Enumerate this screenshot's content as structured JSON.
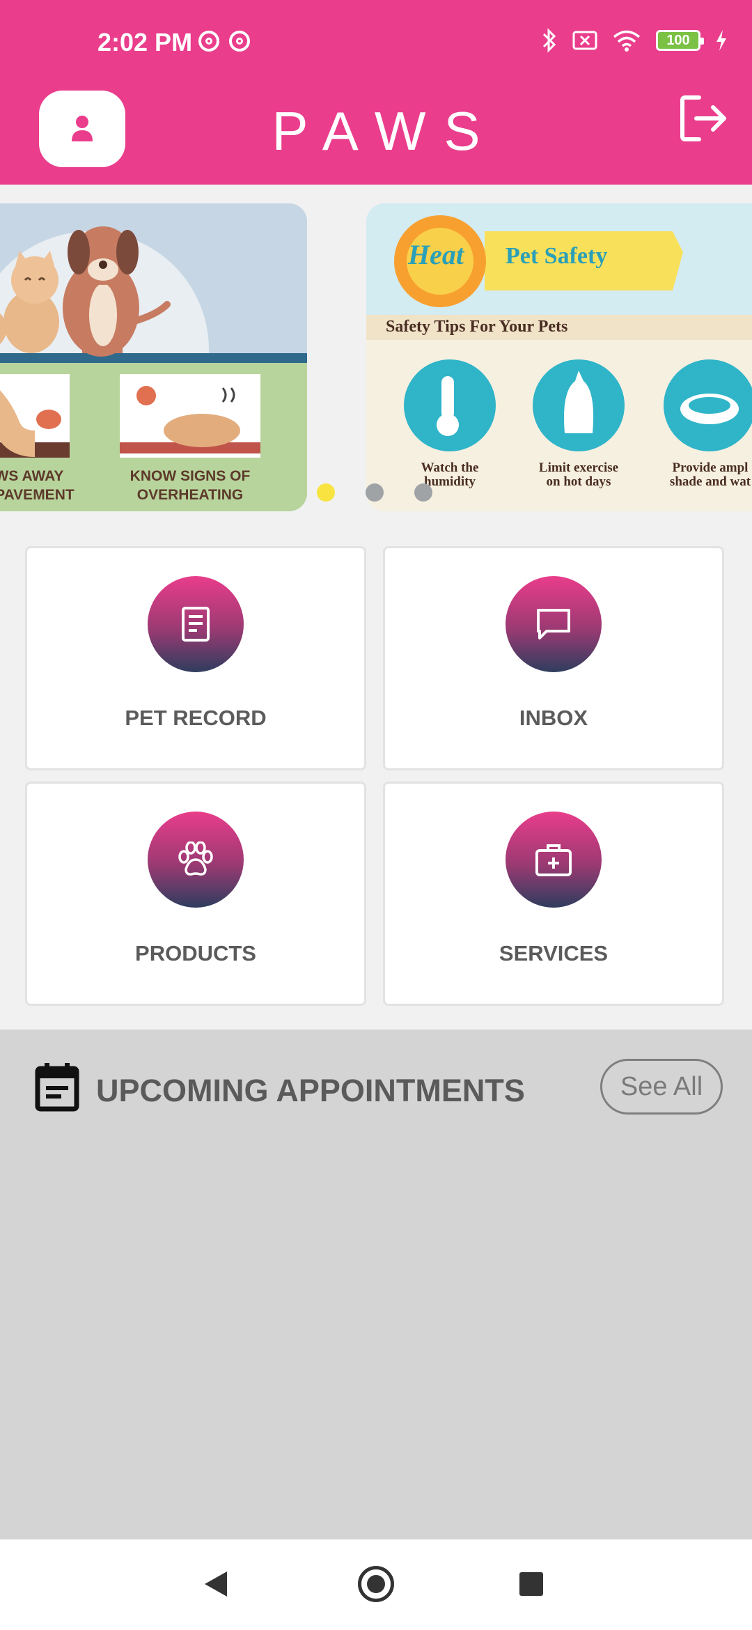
{
  "status_bar": {
    "time": "2:02 PM",
    "battery_level": "100"
  },
  "app": {
    "title": "PAWS"
  },
  "carousel": {
    "slide_left": {
      "captions": [
        "EEP PAWS AWAY\nOM HOT PAVEMENT",
        "KNOW SIGNS OF\nOVERHEATING"
      ]
    },
    "slide_right": {
      "badge": "Heat",
      "banner": "Pet Safety",
      "subtitle": "Safety Tips For Your Pets",
      "tips": [
        "Watch the\nhumidity",
        "Limit exercise\non hot days",
        "Provide ampl\nshade and wat"
      ]
    },
    "active_index": 0,
    "dot_count": 3
  },
  "menu": {
    "pet_record": "PET RECORD",
    "inbox": "INBOX",
    "products": "PRODUCTS",
    "services": "SERVICES"
  },
  "appointments": {
    "title": "UPCOMING APPOINTMENTS",
    "see_all": "See All"
  },
  "colors": {
    "brand": "#ea3d8c",
    "accent_dot": "#f8e341"
  },
  "icons": [
    "profile-icon",
    "logout-icon",
    "document-icon",
    "chat-bubble-icon",
    "paw-icon",
    "medical-kit-icon",
    "calendar-icon"
  ]
}
